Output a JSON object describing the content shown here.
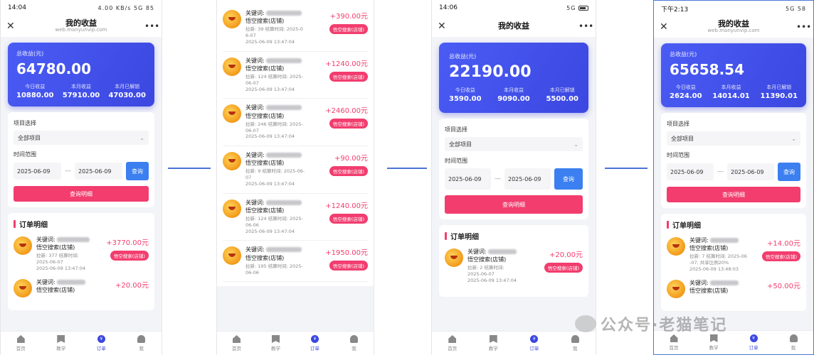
{
  "phone1": {
    "status": {
      "time": "14:04",
      "right": "4.00 KB/s 5G 85"
    },
    "nav": {
      "title": "我的收益",
      "url": "web.manyunvip.com"
    },
    "earnings": {
      "total_label": "总收益(元)",
      "total": "64780.00",
      "stats": [
        {
          "label": "今日收益",
          "value": "10880.00"
        },
        {
          "label": "本月收益",
          "value": "57910.00"
        },
        {
          "label": "本月已解锁",
          "value": "47030.00"
        }
      ]
    },
    "filter": {
      "project_label": "项目选择",
      "project_value": "全部项目",
      "range_label": "时间范围",
      "start": "2025-06-09",
      "end": "2025-06-09",
      "query": "查询",
      "detail": "查询明细"
    },
    "orders_title": "订单明细",
    "orders": [
      {
        "kw": "关键词:",
        "shop": "悟空搜索(店铺)",
        "meta1": "拉新: 377 结算时间:",
        "meta2": "2025-06-07",
        "time": "2025-06-09 13:47:04",
        "amount": "+3770.00元",
        "tag": "悟空搜索(店铺)"
      },
      {
        "kw": "关键词:",
        "shop": "悟空搜索(店铺)",
        "meta1": "",
        "meta2": "",
        "time": "",
        "amount": "+20.00元",
        "tag": ""
      }
    ]
  },
  "phone2": {
    "orders": [
      {
        "kw": "关键词:",
        "shop": "悟空搜索(店铺)",
        "meta1": "拉新: 39 结算时间: 2025-0",
        "meta2": "6-07",
        "time": "2025-06-09 13:47:04",
        "amount": "+390.00元",
        "tag": "悟空搜索(店铺)"
      },
      {
        "kw": "关键词:",
        "shop": "悟空搜索(店铺)",
        "meta1": "拉新: 124 结算时间: 2025-",
        "meta2": "06-07",
        "time": "2025-06-09 13:47:04",
        "amount": "+1240.00元",
        "tag": "悟空搜索(店铺)"
      },
      {
        "kw": "关键词:",
        "shop": "悟空搜索(店铺)",
        "meta1": "拉新: 246 结算时间: 2025-",
        "meta2": "06-07",
        "time": "2025-06-09 13:47:04",
        "amount": "+2460.00元",
        "tag": "悟空搜索(店铺)"
      },
      {
        "kw": "关键词:",
        "shop": "悟空搜索(店铺)",
        "meta1": "拉新: 9 结算时间: 2025-06-",
        "meta2": "07",
        "time": "2025-06-09 13:47:04",
        "amount": "+90.00元",
        "tag": "悟空搜索(店铺)"
      },
      {
        "kw": "关键词:",
        "shop": "悟空搜索(店铺)",
        "meta1": "拉新: 124 结算时间: 2025-",
        "meta2": "06-06",
        "time": "2025-06-09 13:47:04",
        "amount": "+1240.00元",
        "tag": "悟空搜索(店铺)"
      },
      {
        "kw": "关键词:",
        "shop": "悟空搜索(店铺)",
        "meta1": "拉新: 195 结算时间: 2025-",
        "meta2": "06-06",
        "time": "",
        "amount": "+1950.00元",
        "tag": "悟空搜索(店铺)"
      }
    ]
  },
  "phone3": {
    "status": {
      "time": "14:06",
      "right": "5G"
    },
    "nav": {
      "title": "我的收益"
    },
    "earnings": {
      "total_label": "总收益(元)",
      "total": "22190.00",
      "stats": [
        {
          "label": "今日收益",
          "value": "3590.00"
        },
        {
          "label": "本月收益",
          "value": "9090.00"
        },
        {
          "label": "本月已解锁",
          "value": "5500.00"
        }
      ]
    },
    "filter": {
      "project_label": "项目选择",
      "project_value": "全部项目",
      "range_label": "时间范围",
      "start": "2025-06-09",
      "end": "2025-06-09",
      "query": "查询",
      "detail": "查询明细"
    },
    "orders_title": "订单明细",
    "orders": [
      {
        "kw": "关键词:",
        "shop": "悟空搜索(店铺)",
        "meta1": "拉新: 2 结算时间:",
        "meta2": "2025-06-07",
        "time": "2025-06-09 13:47:04",
        "amount": "+20.00元",
        "tag": "悟空搜索(店铺)"
      }
    ]
  },
  "phone4": {
    "status": {
      "time": "下午2:13",
      "right": "5G 58"
    },
    "nav": {
      "title": "我的收益",
      "url": "web.manyunvip.com"
    },
    "earnings": {
      "total_label": "总收益(元)",
      "total": "65658.54",
      "stats": [
        {
          "label": "今日收益",
          "value": "2624.00"
        },
        {
          "label": "本月收益",
          "value": "14014.01"
        },
        {
          "label": "本月已解锁",
          "value": "11390.01"
        }
      ]
    },
    "filter": {
      "project_label": "项目选择",
      "project_value": "全部项目",
      "range_label": "时间范围",
      "start": "2025-06-09",
      "end": "2025-06-09",
      "query": "查询",
      "detail": "查询明细"
    },
    "orders_title": "订单明细",
    "orders": [
      {
        "kw": "关键词:",
        "shop": "悟空搜索(店铺)",
        "meta1": "拉新: 7 结算时间: 2025-06",
        "meta2": "-07, 共享比例20%",
        "time": "2025-06-09 13:48:03",
        "amount": "+14.00元",
        "tag": "悟空搜索(店铺)"
      },
      {
        "kw": "关键词:",
        "shop": "悟空搜索(店铺)",
        "meta1": "",
        "meta2": "",
        "time": "",
        "amount": "+50.00元",
        "tag": ""
      }
    ]
  },
  "tabs": [
    "首页",
    "教学",
    "订单",
    "我"
  ],
  "watermark": "公众号·老猫笔记"
}
